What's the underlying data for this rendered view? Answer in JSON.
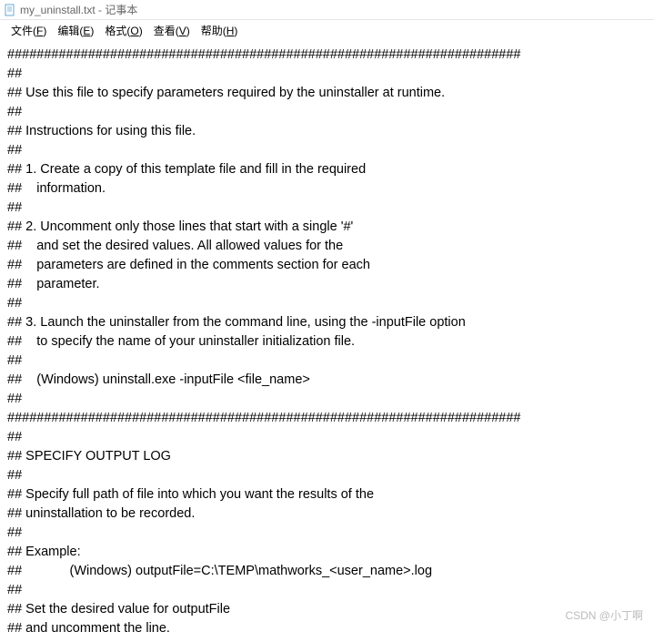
{
  "window": {
    "title": "my_uninstall.txt - 记事本"
  },
  "menu": {
    "file": "文件(",
    "file_u": "F",
    "file_end": ")",
    "edit": "编辑(",
    "edit_u": "E",
    "edit_end": ")",
    "format": "格式(",
    "format_u": "O",
    "format_end": ")",
    "view": "查看(",
    "view_u": "V",
    "view_end": ")",
    "help": "帮助(",
    "help_u": "H",
    "help_end": ")"
  },
  "lines": {
    "l0": "######################################################################",
    "l1": "##",
    "l2": "## Use this file to specify parameters required by the uninstaller at runtime.",
    "l3": "##",
    "l4": "## Instructions for using this file.",
    "l5": "##",
    "l6": "## 1. Create a copy of this template file and fill in the required",
    "l7": "##    information.",
    "l8": "##",
    "l9": "## 2. Uncomment only those lines that start with a single '#'",
    "l10": "##    and set the desired values. All allowed values for the",
    "l11": "##    parameters are defined in the comments section for each",
    "l12": "##    parameter.",
    "l13": "##",
    "l14": "## 3. Launch the uninstaller from the command line, using the -inputFile option",
    "l15": "##    to specify the name of your uninstaller initialization file.",
    "l16": "##",
    "l17": "##    (Windows) uninstall.exe -inputFile <file_name>",
    "l18": "##",
    "l19": "######################################################################",
    "l20": "##",
    "l21": "## SPECIFY OUTPUT LOG",
    "l22": "##",
    "l23": "## Specify full path of file into which you want the results of the",
    "l24": "## uninstallation to be recorded.",
    "l25": "##",
    "l26": "## Example:",
    "l27": "##             (Windows) outputFile=C:\\TEMP\\mathworks_<user_name>.log",
    "l28": "##",
    "l29": "## Set the desired value for outputFile",
    "l30": "## and uncomment the line."
  },
  "watermark": "CSDN @小丁啊"
}
